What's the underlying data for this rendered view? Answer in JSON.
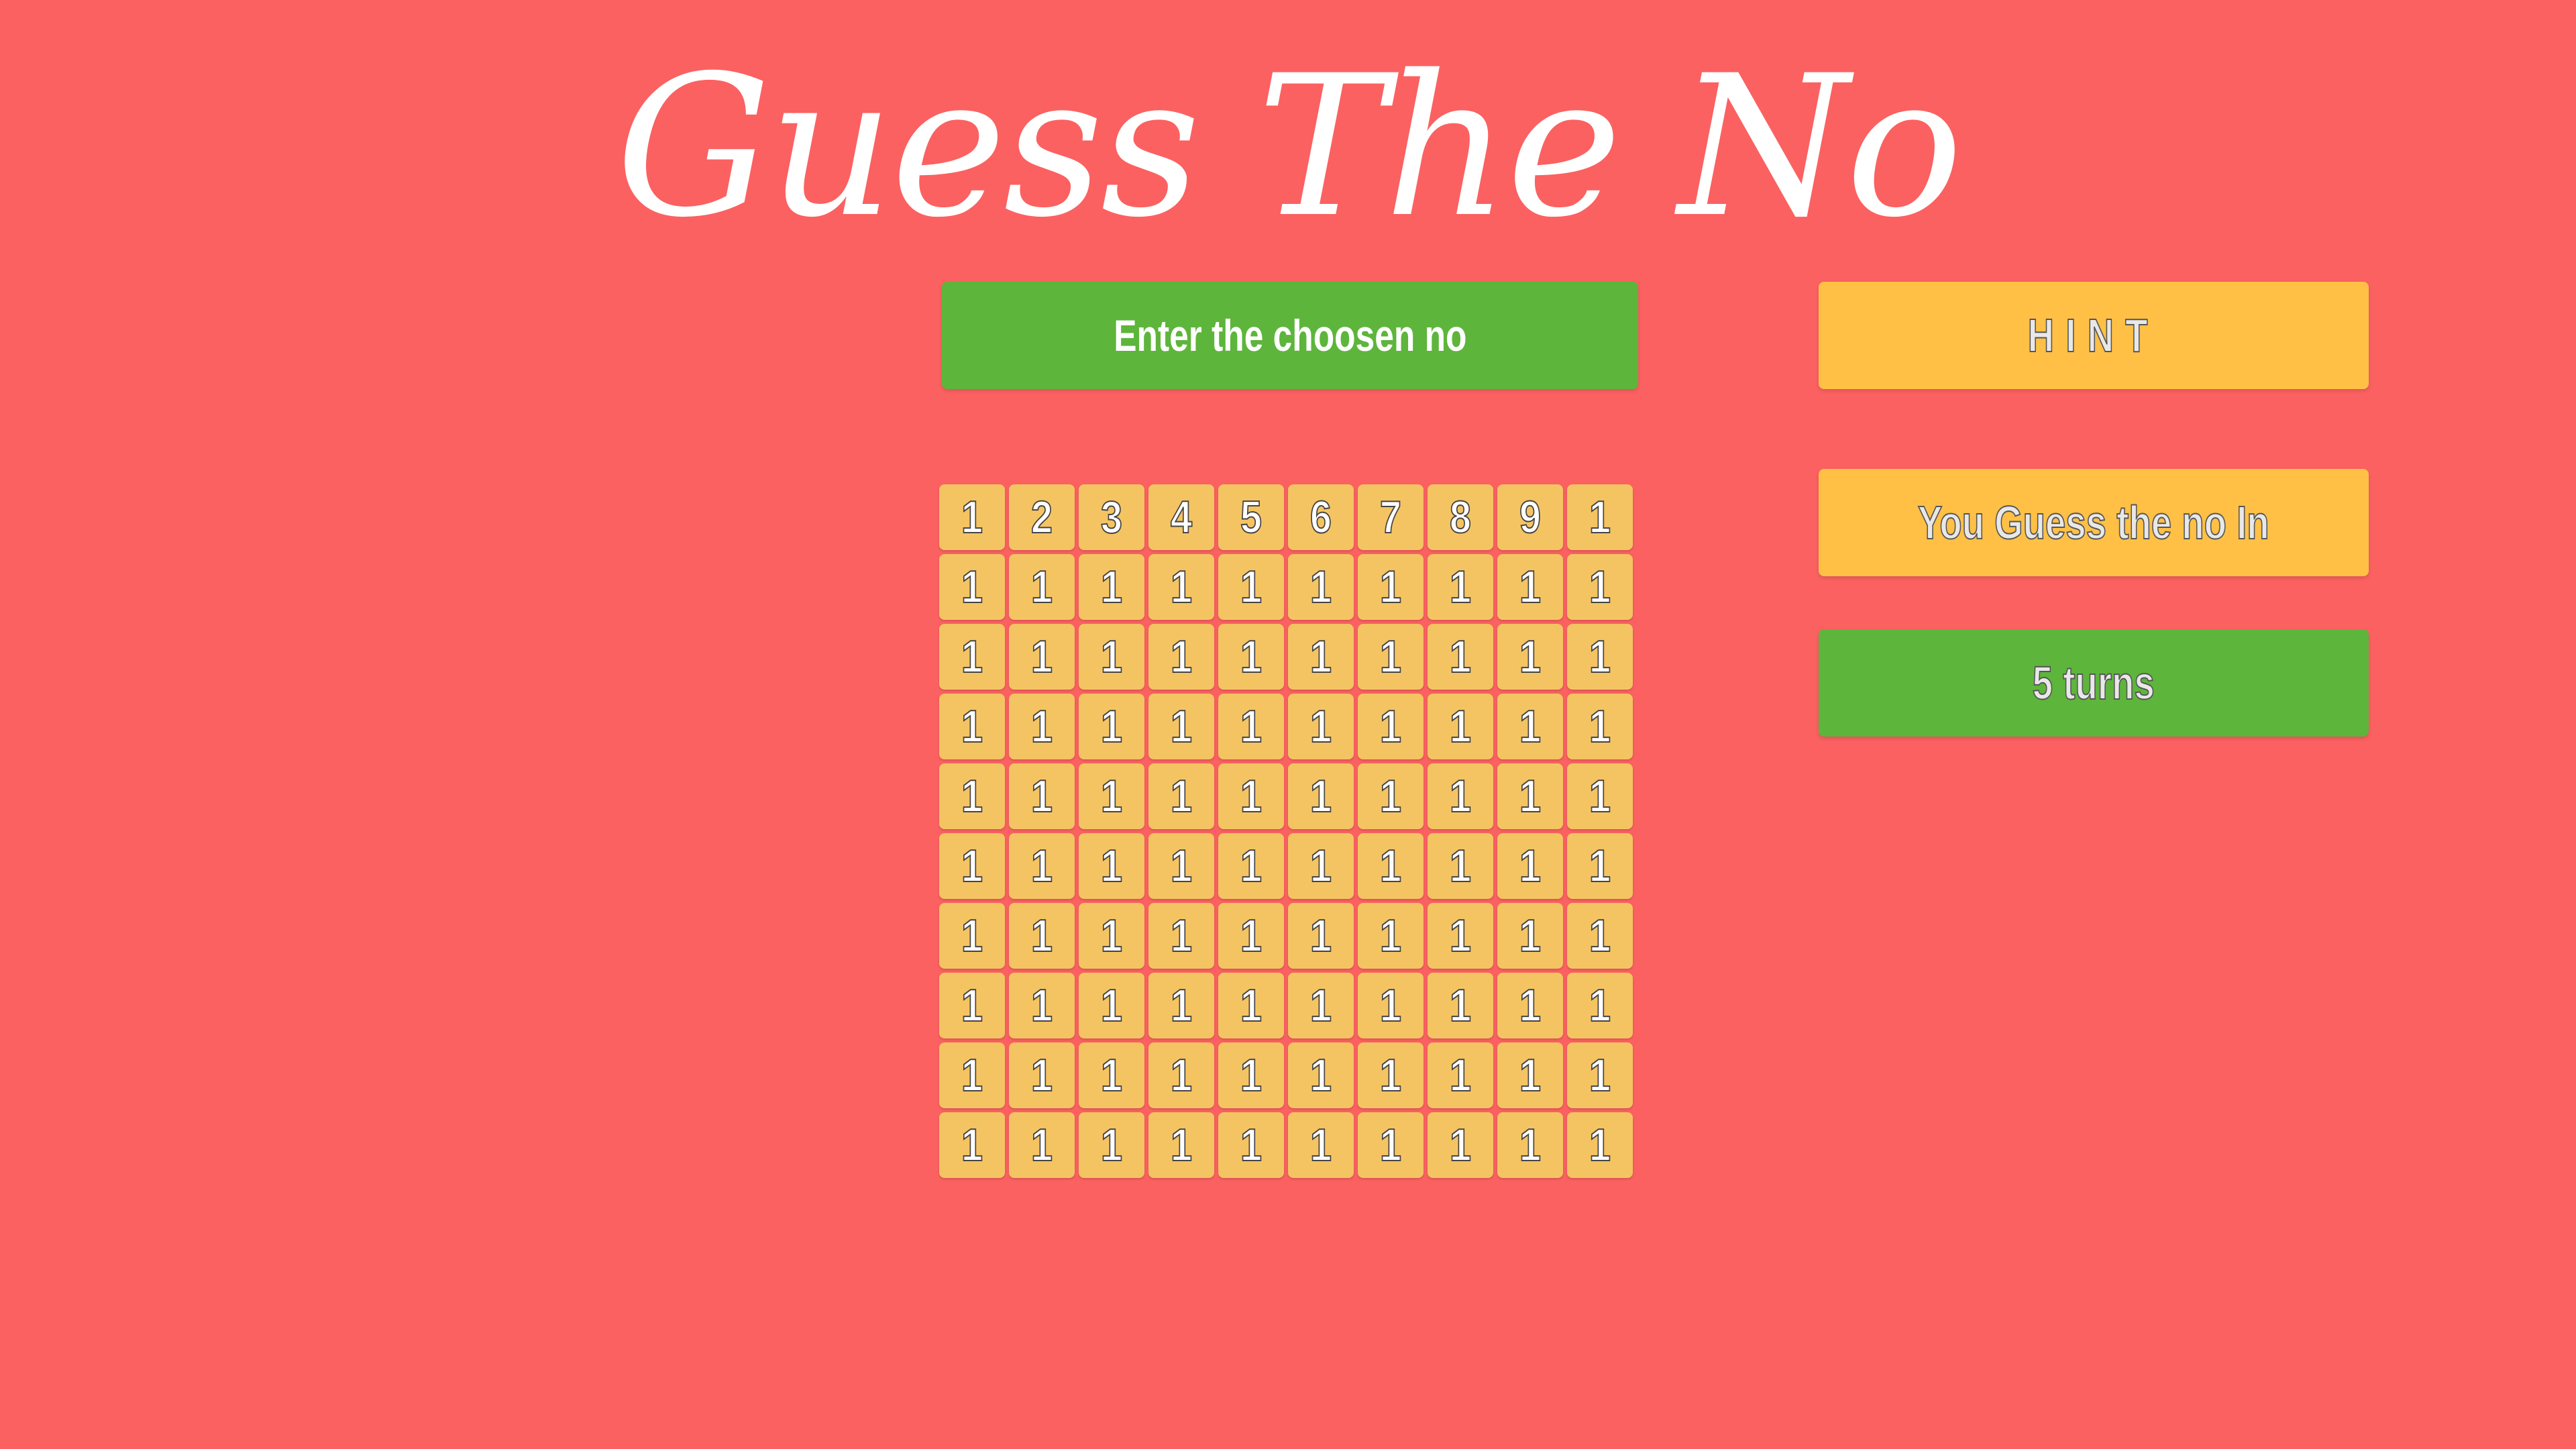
{
  "title": "Guess The No",
  "buttons": {
    "enter_label": "Enter the choosen no",
    "hint_label": "HINT",
    "guess_label": "You Guess the no In",
    "turns_label": "5 turns"
  },
  "grid": {
    "rows": [
      [
        "1",
        "2",
        "3",
        "4",
        "5",
        "6",
        "7",
        "8",
        "9",
        "1"
      ],
      [
        "1",
        "1",
        "1",
        "1",
        "1",
        "1",
        "1",
        "1",
        "1",
        "1"
      ],
      [
        "1",
        "1",
        "1",
        "1",
        "1",
        "1",
        "1",
        "1",
        "1",
        "1"
      ],
      [
        "1",
        "1",
        "1",
        "1",
        "1",
        "1",
        "1",
        "1",
        "1",
        "1"
      ],
      [
        "1",
        "1",
        "1",
        "1",
        "1",
        "1",
        "1",
        "1",
        "1",
        "1"
      ],
      [
        "1",
        "1",
        "1",
        "1",
        "1",
        "1",
        "1",
        "1",
        "1",
        "1"
      ],
      [
        "1",
        "1",
        "1",
        "1",
        "1",
        "1",
        "1",
        "1",
        "1",
        "1"
      ],
      [
        "1",
        "1",
        "1",
        "1",
        "1",
        "1",
        "1",
        "1",
        "1",
        "1"
      ],
      [
        "1",
        "1",
        "1",
        "1",
        "1",
        "1",
        "1",
        "1",
        "1",
        "1"
      ],
      [
        "1",
        "1",
        "1",
        "1",
        "1",
        "1",
        "1",
        "1",
        "1",
        "1"
      ]
    ]
  },
  "colors": {
    "background": "#fb6161",
    "green": "#5eb53b",
    "yellow": "#ffc045",
    "cell": "#f5c462"
  }
}
